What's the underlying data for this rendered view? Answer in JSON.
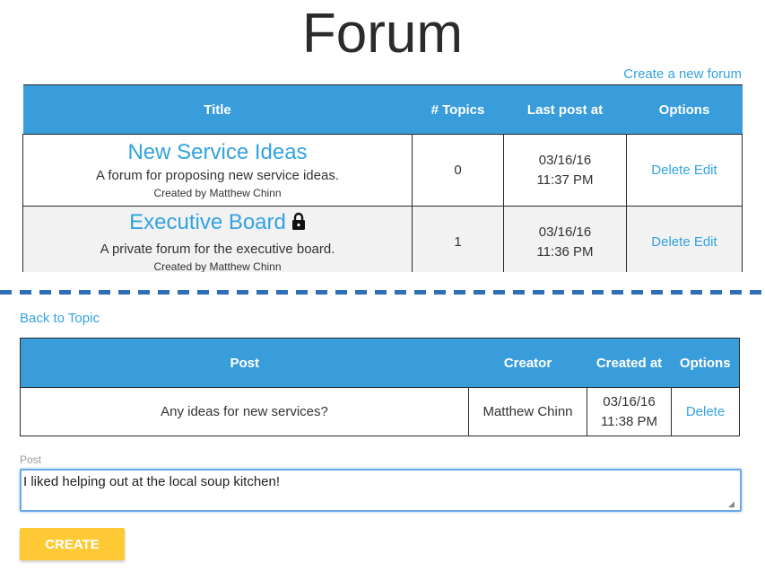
{
  "header": {
    "title": "Forum",
    "create_link": "Create a new forum"
  },
  "forum_table": {
    "columns": [
      "Title",
      "# Topics",
      "Last post at",
      "Options"
    ],
    "rows": [
      {
        "name": "New Service Ideas",
        "description": "A forum for proposing new service ideas.",
        "creator": "Created by Matthew Chinn",
        "topics": "0",
        "date": "03/16/16",
        "time": "11:37 PM",
        "delete": "Delete",
        "edit": "Edit",
        "locked": false
      },
      {
        "name": "Executive Board",
        "description": "A private forum for the executive board.",
        "creator": "Created by Matthew Chinn",
        "topics": "1",
        "date": "03/16/16",
        "time": "11:36 PM",
        "delete": "Delete",
        "edit": "Edit",
        "locked": true,
        "lock_icon": "lock-icon"
      }
    ]
  },
  "topic_view": {
    "back_link": "Back to Topic",
    "columns": [
      "Post",
      "Creator",
      "Created at",
      "Options"
    ],
    "rows": [
      {
        "post": "Any ideas for new services?",
        "creator": "Matthew Chinn",
        "date": "03/16/16",
        "time": "11:38 PM",
        "delete": "Delete"
      }
    ],
    "form": {
      "label": "Post",
      "value": "I liked helping out at the local soup kitchen!",
      "button": "CREATE"
    }
  },
  "colors": {
    "header_blue": "#3a9ddb",
    "link_blue": "#33a3e0",
    "button_yellow": "#fdca35",
    "divider_blue": "#2f6fb7"
  }
}
